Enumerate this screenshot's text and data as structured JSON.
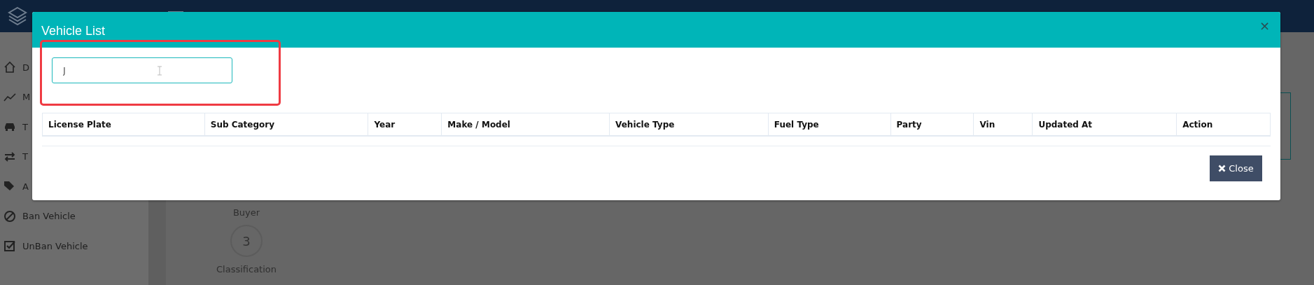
{
  "sidebar": {
    "items": [
      {
        "label": "D"
      },
      {
        "label": "M"
      },
      {
        "label": "T"
      },
      {
        "label": "T"
      },
      {
        "label": "A"
      },
      {
        "label": "Ban Vehicle"
      },
      {
        "label": "UnBan Vehicle"
      }
    ]
  },
  "wizard": {
    "steps": [
      {
        "label": "Buyer"
      },
      {
        "number": "3",
        "label": "Classification"
      }
    ]
  },
  "modal": {
    "title": "Vehicle List",
    "close_glyph": "×",
    "search": {
      "value": "J"
    },
    "table": {
      "columns": [
        "License Plate",
        "Sub Category",
        "Year",
        "Make / Model",
        "Vehicle Type",
        "Fuel Type",
        "Party",
        "Vin",
        "Updated At",
        "Action"
      ]
    },
    "close_button": "Close"
  }
}
